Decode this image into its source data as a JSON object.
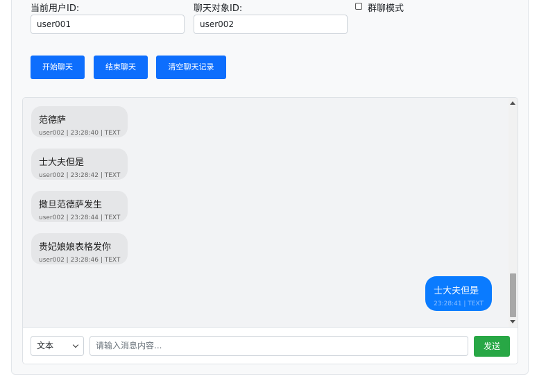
{
  "settings": {
    "current_user_label": "当前用户ID:",
    "current_user_value": "user001",
    "target_label": "聊天对象ID:",
    "target_value": "user002",
    "group_mode_label": "群聊模式",
    "group_mode_checked": false
  },
  "actions": {
    "start": "开始聊天",
    "end": "结束聊天",
    "clear": "清空聊天记录"
  },
  "messages": [
    {
      "text": "范德萨",
      "meta": "user002 | 23:28:40 | TEXT",
      "direction": "incoming"
    },
    {
      "text": "士大夫但是",
      "meta": "user002 | 23:28:42 | TEXT",
      "direction": "incoming"
    },
    {
      "text": "撒旦范德萨发生",
      "meta": "user002 | 23:28:44 | TEXT",
      "direction": "incoming"
    },
    {
      "text": "贵妃娘娘表格发你",
      "meta": "user002 | 23:28:46 | TEXT",
      "direction": "incoming"
    },
    {
      "text": "士大夫但是",
      "meta": "23:28:41 | TEXT",
      "direction": "outgoing"
    }
  ],
  "composer": {
    "type_selected": "文本",
    "placeholder": "请输入消息内容...",
    "send": "发送"
  },
  "colors": {
    "primary": "#0d6efd",
    "send": "#28a745",
    "incoming_bubble": "#e5e6e8",
    "outgoing_bubble": "#0a7bff"
  }
}
